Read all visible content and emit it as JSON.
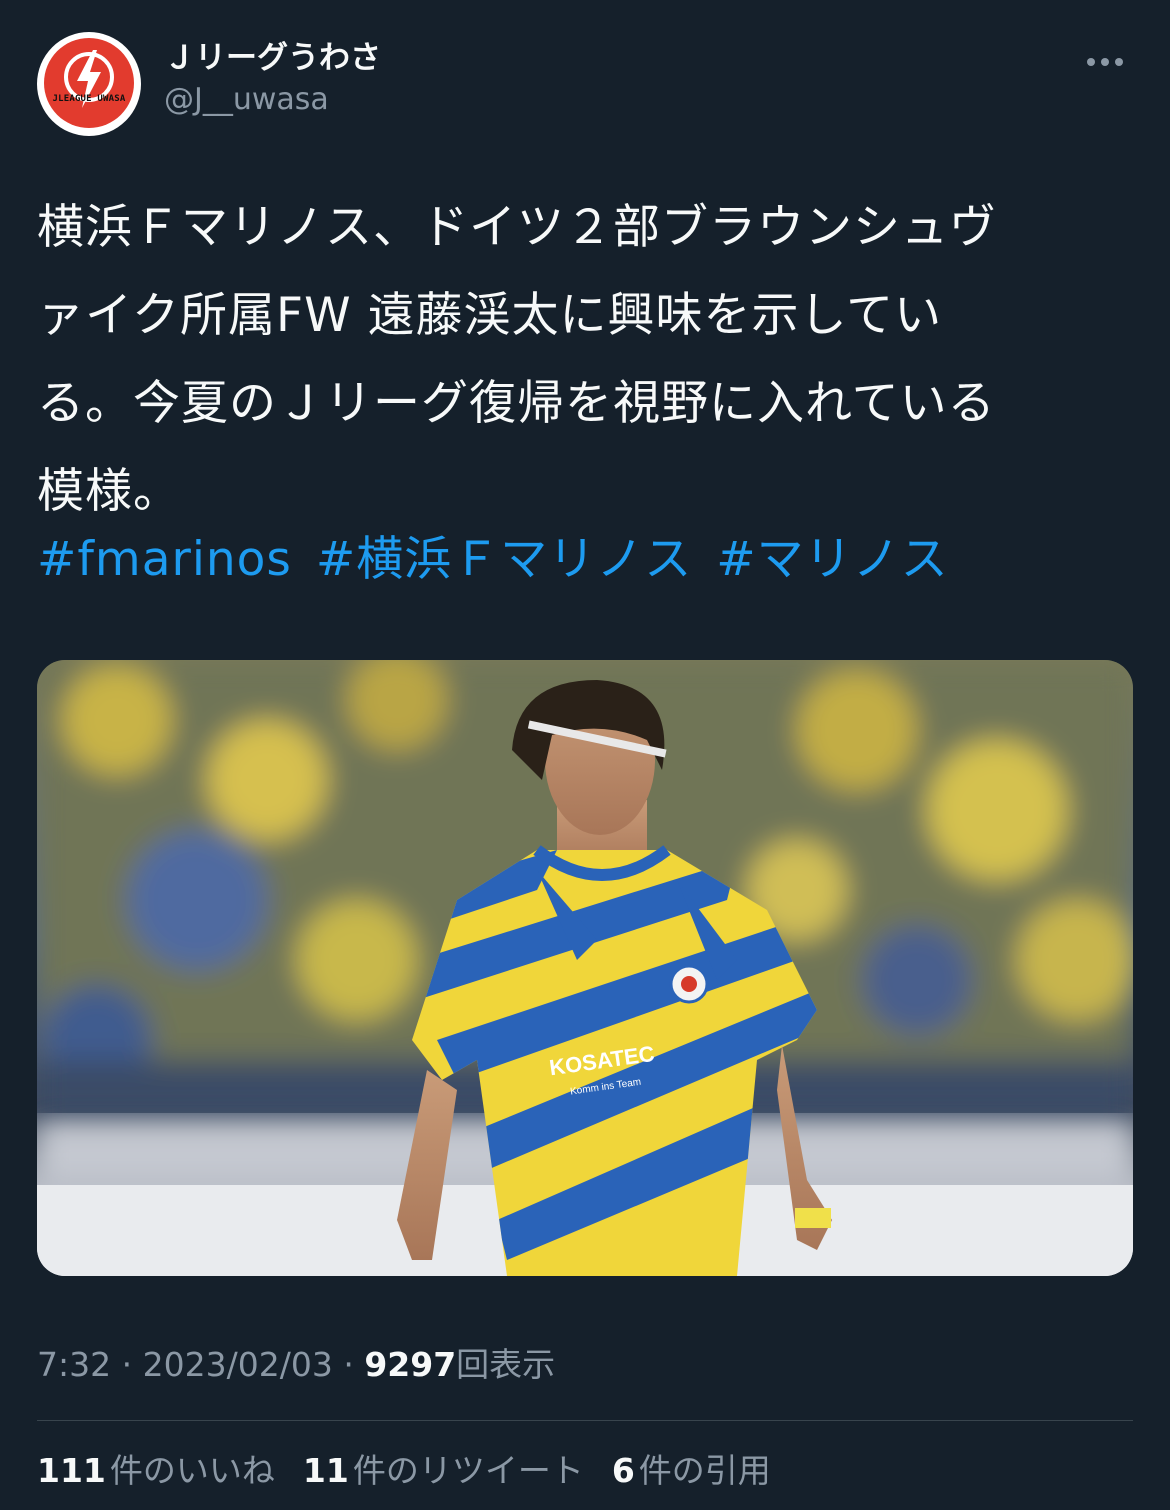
{
  "author": {
    "display_name": "Ｊリーグうわさ",
    "handle": "@J__uwasa",
    "avatar_text": "JLEAGUE UWASA"
  },
  "tweet": {
    "text": "横浜Ｆマリノス、ドイツ２部ブラウンシュヴ\nァイク所属FW 遠藤渓太に興味を示してい\nる。今夏のＪリーグ復帰を視野に入れている\n模様。",
    "hashtags": [
      "#fmarinos",
      "#横浜Ｆマリノス",
      "#マリノス"
    ]
  },
  "media": {
    "jersey_text": "KOSATEC",
    "jersey_subtext": "Komm ins Team"
  },
  "meta": {
    "time": "7:32",
    "sep1": "·",
    "date": "2023/02/03",
    "sep2": "·",
    "views_count": "9297",
    "views_label": "回表示"
  },
  "stats": {
    "likes_count": "111",
    "likes_label": "件のいいね",
    "retweets_count": "11",
    "retweets_label": "件のリツイート",
    "quotes_count": "6",
    "quotes_label": "件の引用"
  },
  "colors": {
    "background": "#15202b",
    "link": "#1d9bf0",
    "muted": "#8b98a5",
    "avatar_red": "#e23b2e"
  }
}
